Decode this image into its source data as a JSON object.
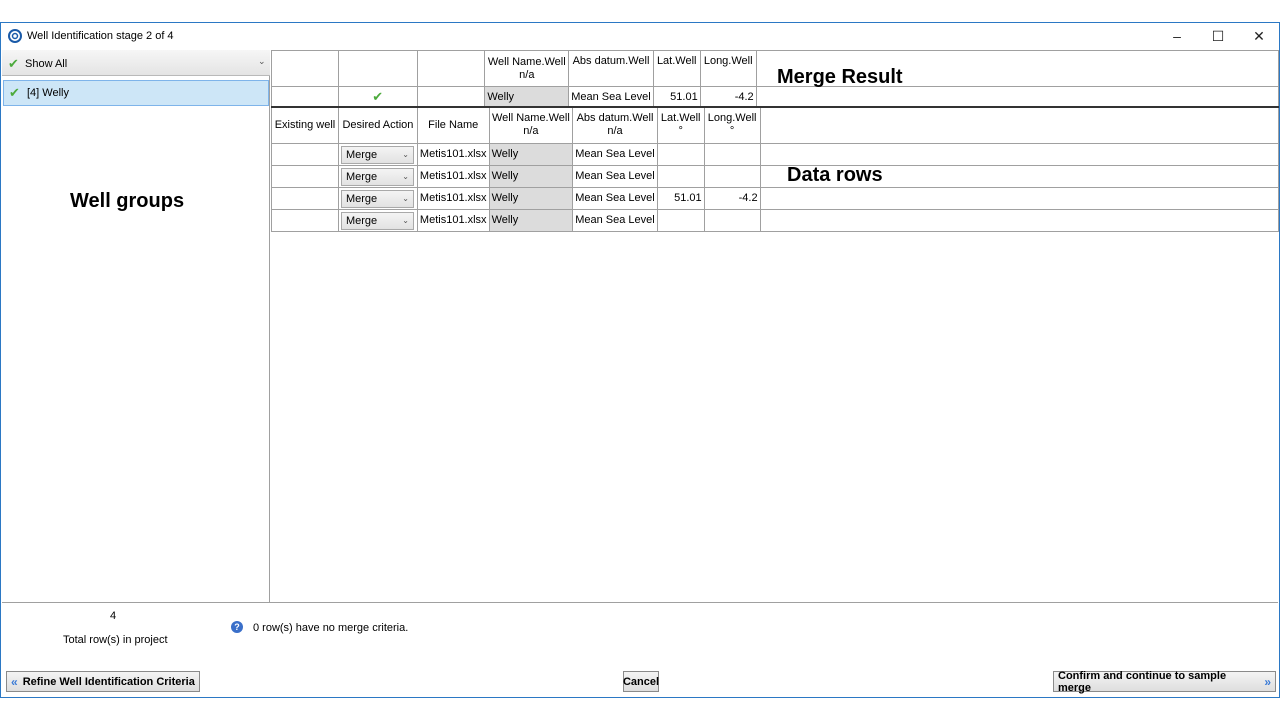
{
  "window": {
    "title": "Well Identification stage 2 of 4",
    "minimize_glyph": "–",
    "maximize_glyph": "☐",
    "close_glyph": "✕"
  },
  "left_pane": {
    "filter_label": "Show All",
    "groups": [
      {
        "label": "[4] Welly"
      }
    ]
  },
  "annotations": {
    "well_groups": "Well groups",
    "merge_result": "Merge Result",
    "data_rows": "Data rows"
  },
  "merge_table": {
    "headers": [
      "",
      "",
      "",
      "Well Name.Well\nn/a",
      "Abs datum.Well",
      "Lat.Well",
      "Long.Well",
      ""
    ],
    "row": {
      "existing": "",
      "check": "✔",
      "file": "",
      "name": "Welly",
      "abs": "Mean Sea Level",
      "lat": "51.01",
      "long": "-4.2"
    }
  },
  "data_table": {
    "headers": [
      "Existing well",
      "Desired Action",
      "File Name",
      "Well Name.Well\nn/a",
      "Abs datum.Well\nn/a",
      "Lat.Well\n°",
      "Long.Well\n°",
      ""
    ],
    "rows": [
      {
        "existing": "",
        "action": "Merge",
        "file": "Metis101.xlsx",
        "name": "Welly",
        "abs": "Mean Sea Level",
        "lat": "",
        "long": ""
      },
      {
        "existing": "",
        "action": "Merge",
        "file": "Metis101.xlsx",
        "name": "Welly",
        "abs": "Mean Sea Level",
        "lat": "",
        "long": ""
      },
      {
        "existing": "",
        "action": "Merge",
        "file": "Metis101.xlsx",
        "name": "Welly",
        "abs": "Mean Sea Level",
        "lat": "51.01",
        "long": "-4.2"
      },
      {
        "existing": "",
        "action": "Merge",
        "file": "Metis101.xlsx",
        "name": "Welly",
        "abs": "Mean Sea Level",
        "lat": "",
        "long": ""
      }
    ]
  },
  "footer": {
    "total_rows": "4",
    "total_rows_label": "Total row(s) in project",
    "info_text": "0 row(s) have no merge criteria."
  },
  "buttons": {
    "refine": "Refine Well Identification Criteria",
    "cancel": "Cancel",
    "confirm": "Confirm and continue to sample merge"
  },
  "colors": {
    "accent_check": "#4caa3c",
    "selection": "#cde6f7",
    "arrow_blue": "#3b7bd6"
  }
}
